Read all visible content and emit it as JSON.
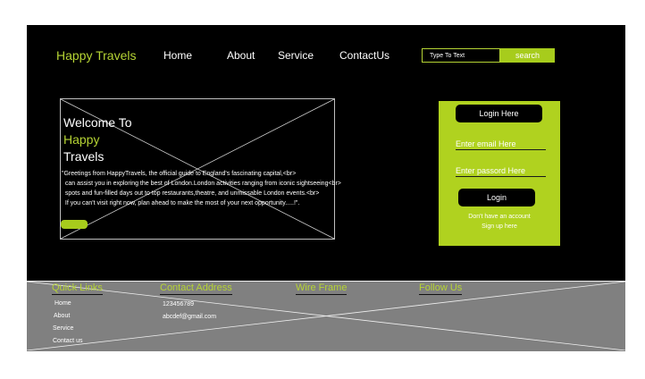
{
  "brand": "Happy Travels",
  "nav": [
    "Home",
    "About",
    "Service",
    "ContactUs"
  ],
  "search": {
    "placeholder": "Type To Text",
    "button": "search"
  },
  "hero": {
    "line1": "Welcome To",
    "line2": "Happy",
    "line3": "Travels",
    "text": "\"Greetings from HappyTravels, the official guide to England's fascinating capital,<br>\n  can assist you in exploring the best of London.London activities ranging from iconic sightseeing<br>\n  spots and fun-filled days out to top restaurants,theatre, and unmissable London events.<br>\n  If you can't visit right now, plan ahead to make the most of your next opportunity.....!\"."
  },
  "login": {
    "title": "Login Here",
    "email": "Enter email Here",
    "password": "Enter passord Here",
    "button": "Login",
    "signup_line1": "Don't have an account",
    "signup_line2": "Sign up  here"
  },
  "footer": {
    "quick_links_title": "Quick Links",
    "quick_links": [
      "Home",
      "About",
      "Service",
      "Contact us"
    ],
    "contact_title": "Contact Address",
    "phone": "123456789",
    "email": "abcdef@gmail.com",
    "wireframe_title": "Wire Frame",
    "follow_title": "Follow Us"
  },
  "colors": {
    "background": "#000000",
    "accent": "#b5d334",
    "button": "#a7cc1c",
    "footer": "#808080"
  }
}
